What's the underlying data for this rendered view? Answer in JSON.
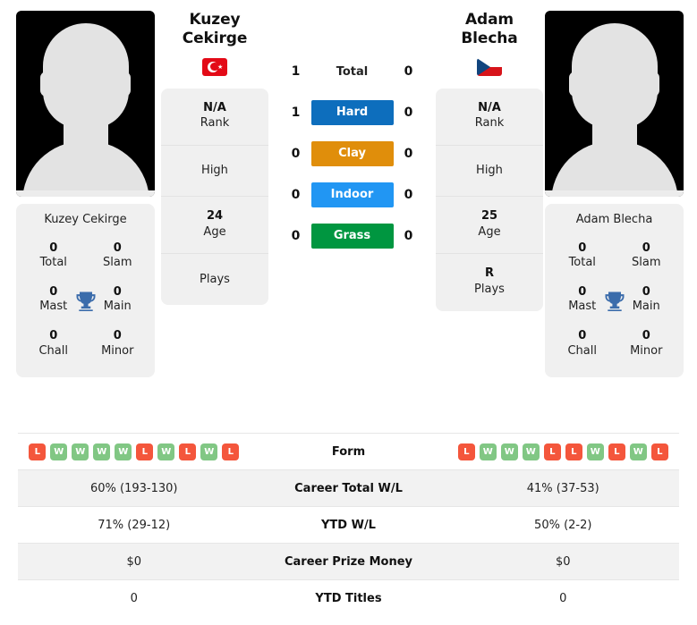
{
  "players": {
    "left": {
      "name": "Kuzey Cekirge",
      "display_name_line1": "Kuzey",
      "display_name_line2": "Cekirge",
      "country": "Turkey",
      "flag_icon": "turkey-flag-icon",
      "photo_placeholder": "avatar-silhouette-icon",
      "titles": {
        "card_name": "Kuzey Cekirge",
        "total_value": "0",
        "total_label": "Total",
        "slam_value": "0",
        "slam_label": "Slam",
        "mast_value": "0",
        "mast_label": "Mast",
        "main_value": "0",
        "main_label": "Main",
        "chall_value": "0",
        "chall_label": "Chall",
        "minor_value": "0",
        "minor_label": "Minor",
        "trophy_icon": "trophy-icon"
      },
      "info": {
        "rank_value": "N/A",
        "rank_label": "Rank",
        "high_value": "",
        "high_label": "High",
        "age_value": "24",
        "age_label": "Age",
        "plays_value": "",
        "plays_label": "Plays"
      },
      "form": [
        "L",
        "W",
        "W",
        "W",
        "W",
        "L",
        "W",
        "L",
        "W",
        "L"
      ],
      "career_total_wl": "60% (193-130)",
      "ytd_wl": "71% (29-12)",
      "career_prize_money": "$0",
      "ytd_titles": "0"
    },
    "right": {
      "name": "Adam Blecha",
      "display_name_line1": "Adam Blecha",
      "display_name_line2": "",
      "country": "Czech Republic",
      "flag_icon": "czech-republic-flag-icon",
      "photo_placeholder": "avatar-silhouette-icon",
      "titles": {
        "card_name": "Adam Blecha",
        "total_value": "0",
        "total_label": "Total",
        "slam_value": "0",
        "slam_label": "Slam",
        "mast_value": "0",
        "mast_label": "Mast",
        "main_value": "0",
        "main_label": "Main",
        "chall_value": "0",
        "chall_label": "Chall",
        "minor_value": "0",
        "minor_label": "Minor",
        "trophy_icon": "trophy-icon"
      },
      "info": {
        "rank_value": "N/A",
        "rank_label": "Rank",
        "high_value": "",
        "high_label": "High",
        "age_value": "25",
        "age_label": "Age",
        "plays_value": "R",
        "plays_label": "Plays"
      },
      "form": [
        "L",
        "W",
        "W",
        "W",
        "L",
        "L",
        "W",
        "L",
        "W",
        "L"
      ],
      "career_total_wl": "41% (37-53)",
      "ytd_wl": "50% (2-2)",
      "career_prize_money": "$0",
      "ytd_titles": "0"
    }
  },
  "head_to_head": [
    {
      "label": "Total",
      "left": "1",
      "right": "0",
      "style": "plain",
      "color": ""
    },
    {
      "label": "Hard",
      "left": "1",
      "right": "0",
      "style": "badge",
      "color": "#0d6ebd"
    },
    {
      "label": "Clay",
      "left": "0",
      "right": "0",
      "style": "badge",
      "color": "#e08e0b"
    },
    {
      "label": "Indoor",
      "left": "0",
      "right": "0",
      "style": "badge",
      "color": "#2196f3"
    },
    {
      "label": "Grass",
      "left": "0",
      "right": "0",
      "style": "badge",
      "color": "#009640"
    }
  ],
  "stats_table": [
    {
      "label": "Form",
      "type": "form"
    },
    {
      "label": "Career Total W/L",
      "type": "text",
      "key": "career_total_wl"
    },
    {
      "label": "YTD W/L",
      "type": "text",
      "key": "ytd_wl"
    },
    {
      "label": "Career Prize Money",
      "type": "text",
      "key": "career_prize_money"
    },
    {
      "label": "YTD Titles",
      "type": "text",
      "key": "ytd_titles"
    }
  ],
  "colors": {
    "win_badge": "#81c784",
    "loss_badge": "#f4563c",
    "card_bg": "#f0f0f0",
    "row_alt_bg": "#f2f2f2",
    "trophy": "#3b6cab"
  }
}
